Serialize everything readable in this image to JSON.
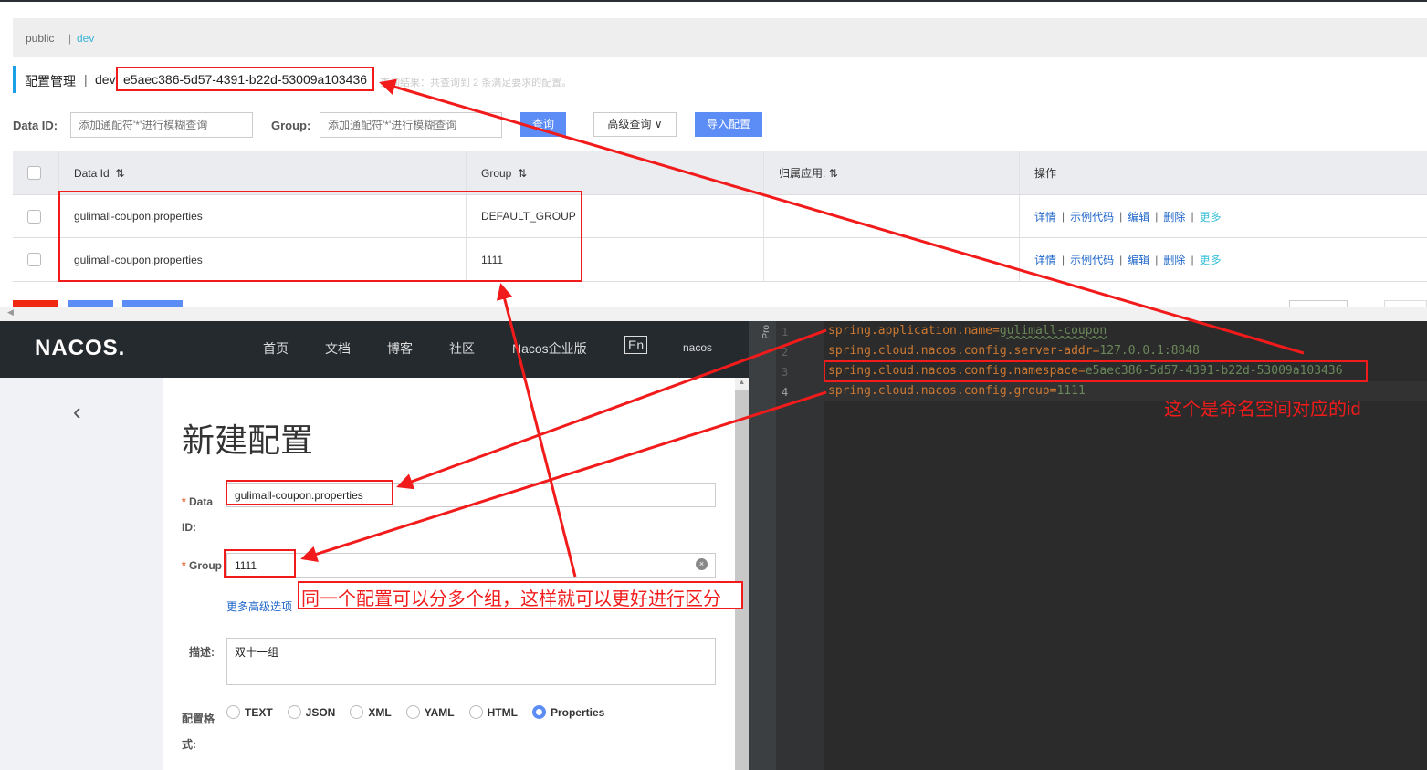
{
  "namespace_tabs": [
    "public",
    "dev"
  ],
  "config_header": {
    "title": "配置管理",
    "namespace": "dev",
    "namespace_id": "e5aec386-5d57-4391-b22d-53009a103436",
    "result": "查询结果：共查询到 2 条满足要求的配置。"
  },
  "search": {
    "data_id_label": "Data ID:",
    "data_id_placeholder": "添加通配符'*'进行模糊查询",
    "group_label": "Group:",
    "group_placeholder": "添加通配符'*'进行模糊查询",
    "query_label": "查询",
    "advanced_label": "高级查询",
    "import_label": "导入配置"
  },
  "table": {
    "headers": [
      "Data Id",
      "Group",
      "归属应用:",
      "操作"
    ],
    "rows": [
      {
        "data_id": "gulimall-coupon.properties",
        "group": "DEFAULT_GROUP",
        "app": ""
      },
      {
        "data_id": "gulimall-coupon.properties",
        "group": "1111",
        "app": ""
      }
    ],
    "actions": [
      "详情",
      "示例代码",
      "编辑",
      "删除",
      "更多"
    ]
  },
  "nacos": {
    "logo": "NACOS.",
    "nav": [
      "首页",
      "文档",
      "博客",
      "社区",
      "Nacos企业版"
    ],
    "lang": "En",
    "user": "nacos",
    "page_title": "新建配置",
    "form": {
      "data_id_label": "Data ID:",
      "data_id_value": "gulimall-coupon.properties",
      "group_label": "Group",
      "group_value": "1111",
      "more_options": "更多高级选项",
      "desc_label": "描述:",
      "desc_value": "双十一组",
      "format_label": "配置格式:",
      "formats": [
        "TEXT",
        "JSON",
        "XML",
        "YAML",
        "HTML",
        "Properties"
      ],
      "selected_format": "Properties"
    }
  },
  "editor": {
    "side_tab": "Pro",
    "lines": [
      {
        "n": "1",
        "key": "spring.application.name",
        "val": "gulimall-coupon"
      },
      {
        "n": "2",
        "key": "spring.cloud.nacos.config.server-addr",
        "val": "127.0.0.1:8848"
      },
      {
        "n": "3",
        "key": "spring.cloud.nacos.config.namespace",
        "val": "e5aec386-5d57-4391-b22d-53009a103436"
      },
      {
        "n": "4",
        "key": "spring.cloud.nacos.config.group",
        "val": "1111"
      }
    ]
  },
  "annotations": {
    "namespace_note": "这个是命名空间对应的id",
    "group_note": "同一个配置可以分多个组，这样就可以更好进行区分"
  },
  "colors": {
    "annotation": "#f21b1b",
    "primary": "#5c8df6",
    "nacos_header": "#252a2f",
    "editor_bg": "#2b2b2b"
  }
}
